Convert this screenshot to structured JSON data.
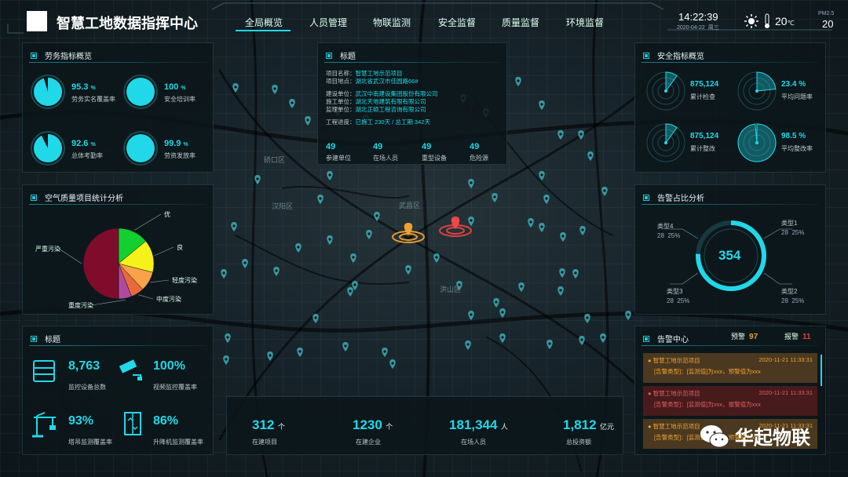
{
  "header": {
    "title": "智慧工地数据指挥中心",
    "time": "14:22:39",
    "date": "2020-04-22",
    "weekday": "周三",
    "temp": "20",
    "temp_unit": "℃",
    "pm_label": "PM2.5",
    "pm_value": "20"
  },
  "nav": [
    "全局概览",
    "人员管理",
    "物联监测",
    "安全监督",
    "质量监督",
    "环境监督"
  ],
  "labor": {
    "title": "劳务指标概览",
    "items": [
      {
        "value": "95.3",
        "unit": "%",
        "label": "劳务实名覆盖率",
        "fraction": 0.953
      },
      {
        "value": "100",
        "unit": "%",
        "label": "安全培训率",
        "fraction": 1.0
      },
      {
        "value": "92.6",
        "unit": "%",
        "label": "总体考勤率",
        "fraction": 0.926
      },
      {
        "value": "99.9",
        "unit": "%",
        "label": "劳资发放率",
        "fraction": 0.999
      }
    ]
  },
  "air": {
    "title": "空气质量项目统计分析",
    "legend": [
      "优",
      "良",
      "轻度污染",
      "中度污染",
      "重度污染",
      "严重污染"
    ]
  },
  "chart_data": {
    "type": "pie",
    "categories": [
      "优",
      "良",
      "轻度污染",
      "中度污染",
      "重度污染",
      "严重污染"
    ],
    "values": [
      14,
      15,
      9,
      6,
      6,
      50
    ]
  },
  "device": {
    "title": "标题",
    "items": [
      {
        "value": "8,763",
        "label": "监控设备总数",
        "icon": "server-icon"
      },
      {
        "value": "100%",
        "label": "视频监控覆盖率",
        "icon": "camera-icon"
      },
      {
        "value": "93%",
        "label": "塔吊监测覆盖率",
        "icon": "crane-icon"
      },
      {
        "value": "86%",
        "label": "升降机监测覆盖率",
        "icon": "elevator-icon"
      }
    ]
  },
  "project": {
    "title": "标题",
    "rows": [
      {
        "k": "项目名称：",
        "v": "智慧工地示范项目"
      },
      {
        "k": "项目地点：",
        "v": "湖北省武汉市佳园路66#"
      },
      {
        "k": "建设单位：",
        "v": "武汉中南建设集团股份有限公司"
      },
      {
        "k": "施工单位：",
        "v": "湖北天地建筑有限有限公司"
      },
      {
        "k": "监理单位：",
        "v": "湖北正硕工程咨询有限公司"
      }
    ],
    "progress_label": "工程进度：",
    "progress_value": "已施工 230天 / 总工期 342天",
    "stats": [
      {
        "v": "49",
        "l": "参建单位"
      },
      {
        "v": "49",
        "l": "在场人员"
      },
      {
        "v": "49",
        "l": "重型设备"
      },
      {
        "v": "49",
        "l": "危险源"
      }
    ]
  },
  "safety": {
    "title": "安全指标概览",
    "items": [
      {
        "value": "875,124",
        "label": "累计检查",
        "fraction": 0.1
      },
      {
        "value": "23.4 %",
        "label": "平均问题率",
        "fraction": 0.234
      },
      {
        "value": "875,124",
        "label": "累计整改",
        "fraction": 0.1
      },
      {
        "value": "98.5 %",
        "label": "平均整改率",
        "fraction": 0.985
      }
    ]
  },
  "alarm_ratio": {
    "title": "告警占比分析",
    "center": "354",
    "types": [
      {
        "name": "类型1",
        "count": "28",
        "pct": "25%"
      },
      {
        "name": "类型2",
        "count": "28",
        "pct": "25%"
      },
      {
        "name": "类型3",
        "count": "28",
        "pct": "25%"
      },
      {
        "name": "类型4",
        "count": "28",
        "pct": "25%"
      }
    ]
  },
  "alarm_center": {
    "title": "告警中心",
    "warn_label": "预警",
    "warn_count": "97",
    "alarm_label": "报警",
    "alarm_count": "11",
    "items": [
      {
        "project": "智慧工地示范项目",
        "time": "2020-11-21 11:33:31",
        "detail": "[告警类型]：[监测值]为xxx，预警值为xxx",
        "level": "warn"
      },
      {
        "project": "智慧工地示范项目",
        "time": "2020-11-21 11:33:31",
        "detail": "[告警类型]：[监测值]为xxx，报警值为xxx",
        "level": "alarm"
      },
      {
        "project": "智慧工地示范项目",
        "time": "2020-11-21 11:33:31",
        "detail": "[告警类型]：[监测值]为xxx，预警值为xxx",
        "level": "warn"
      }
    ]
  },
  "bottom": [
    {
      "value": "312",
      "unit": "个",
      "label": "在建项目"
    },
    {
      "value": "1230",
      "unit": "个",
      "label": "在建企业"
    },
    {
      "value": "181,344",
      "unit": "人",
      "label": "在场人员"
    },
    {
      "value": "1,812",
      "unit": "亿元",
      "label": "总投资额"
    }
  ],
  "map_labels": [
    "硚口区",
    "汉阳区",
    "武昌区",
    "洪山区"
  ],
  "watermark": "华起物联",
  "colors": {
    "accent": "#20d8e8",
    "warn": "#f0a030",
    "alarm": "#e04040"
  }
}
